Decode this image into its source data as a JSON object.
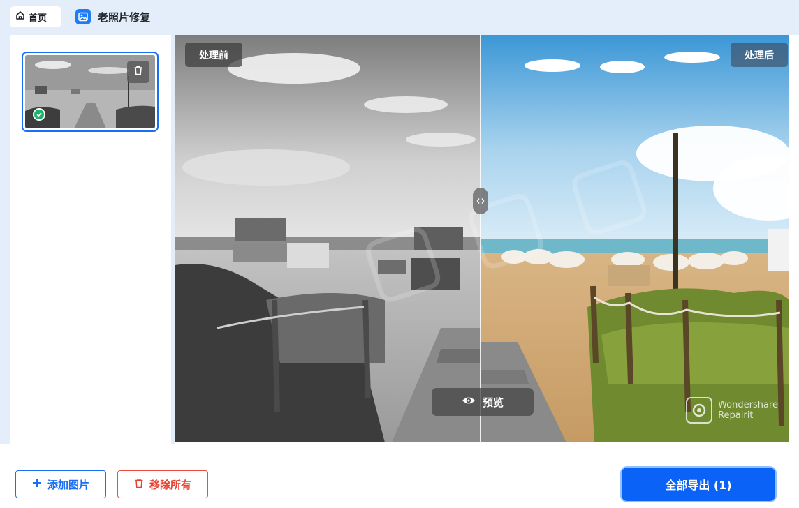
{
  "header": {
    "home_label": "首页",
    "home_icon": "home-icon",
    "app_title": "老照片修复",
    "app_icon": "image-icon"
  },
  "sidebar": {
    "thumbnail": {
      "delete_icon": "trash-icon",
      "status_icon": "check-circle-icon",
      "status_color": "#20b26b"
    }
  },
  "compare": {
    "before_label": "处理前",
    "after_label": "处理后",
    "split_handle_icon": "split-arrows-icon",
    "preview_label": "预览",
    "preview_icon": "eye-icon",
    "watermark_line1": "Wondershare",
    "watermark_line2": "Repairit"
  },
  "footer": {
    "add_label": "添加图片",
    "add_icon": "plus-icon",
    "remove_label": "移除所有",
    "remove_icon": "trash-icon",
    "export_label": "全部导出 (1)"
  },
  "colors": {
    "accent": "#1a6ef5",
    "danger": "#e8412f",
    "export_bg": "#0a62f7",
    "page_bg": "#e4eefb"
  }
}
